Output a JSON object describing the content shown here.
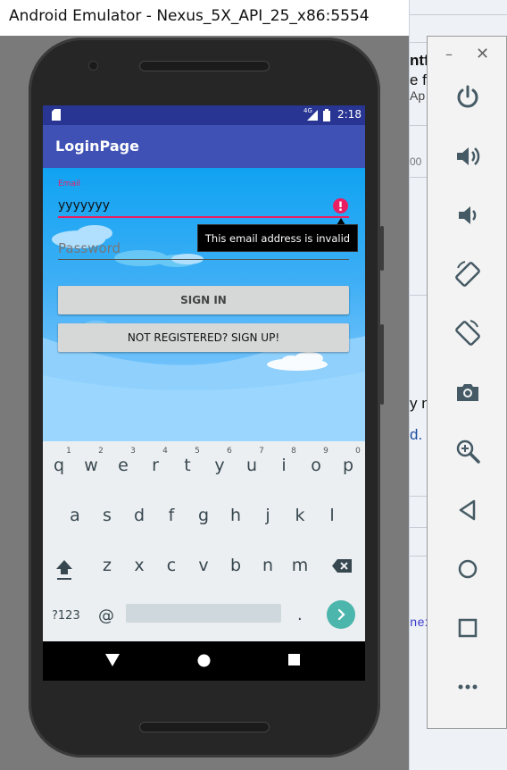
{
  "window": {
    "title": "Android Emulator - Nexus_5X_API_25_x86:5554"
  },
  "ide_fragments": [
    "ntf",
    "e f",
    "Ap",
    "00",
    "y n",
    "d. (",
    "nex"
  ],
  "status_bar": {
    "network": "4G",
    "time": "2:18"
  },
  "app": {
    "title": "LoginPage"
  },
  "form": {
    "email_label": "Email",
    "email_value": "yyyyyyy",
    "error_tooltip": "This email address is invalid",
    "password_placeholder": "Password",
    "sign_in_label": "SIGN IN",
    "sign_up_label": "NOT REGISTERED? SIGN UP!"
  },
  "keyboard": {
    "row1": [
      "q",
      "w",
      "e",
      "r",
      "t",
      "y",
      "u",
      "i",
      "o",
      "p"
    ],
    "row1_hints": [
      "1",
      "2",
      "3",
      "4",
      "5",
      "6",
      "7",
      "8",
      "9",
      "0"
    ],
    "row2": [
      "a",
      "s",
      "d",
      "f",
      "g",
      "h",
      "j",
      "k",
      "l"
    ],
    "row3": [
      "z",
      "x",
      "c",
      "v",
      "b",
      "n",
      "m"
    ],
    "symbols_key": "?123",
    "at_key": "@",
    "period_key": "."
  },
  "toolbar": {
    "icons": [
      "power-icon",
      "volume-up-icon",
      "volume-down-icon",
      "rotate-left-icon",
      "rotate-right-icon",
      "camera-icon",
      "zoom-icon",
      "back-icon",
      "home-icon",
      "overview-icon",
      "more-icon"
    ]
  },
  "colors": {
    "primary": "#3f51b5",
    "primary_dark": "#283593",
    "error": "#e91e63",
    "accent": "#4db6ac"
  }
}
